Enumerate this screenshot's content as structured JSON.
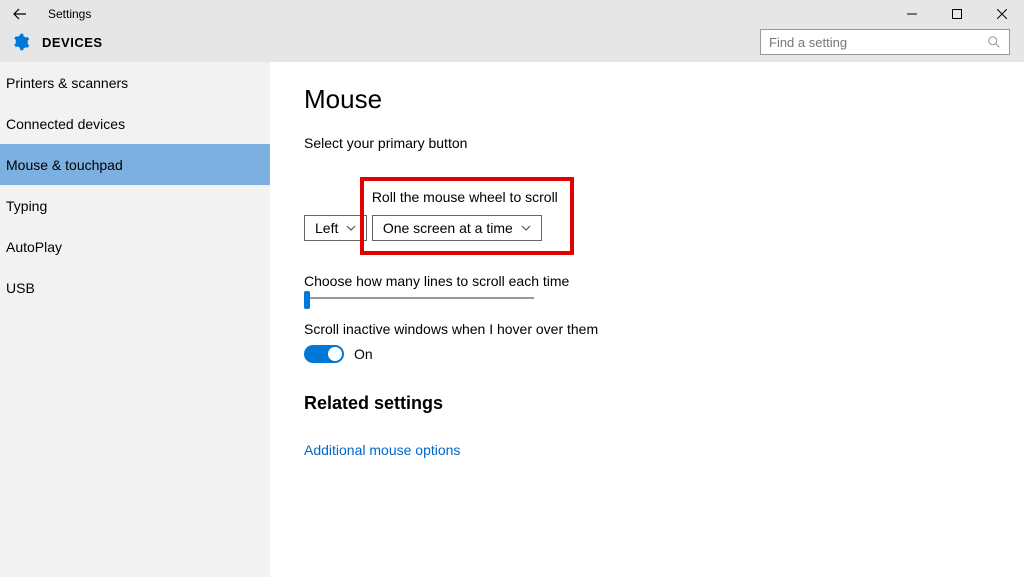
{
  "titlebar": {
    "title": "Settings"
  },
  "header": {
    "title": "DEVICES",
    "search_placeholder": "Find a setting"
  },
  "sidebar": {
    "items": [
      {
        "label": "Printers & scanners"
      },
      {
        "label": "Connected devices"
      },
      {
        "label": "Mouse & touchpad"
      },
      {
        "label": "Typing"
      },
      {
        "label": "AutoPlay"
      },
      {
        "label": "USB"
      }
    ]
  },
  "main": {
    "title": "Mouse",
    "primary_button_label": "Select your primary button",
    "primary_button_value": "Left",
    "scroll_mode_label": "Roll the mouse wheel to scroll",
    "scroll_mode_value": "One screen at a time",
    "lines_label": "Choose how many lines to scroll each time",
    "inactive_label": "Scroll inactive windows when I hover over them",
    "inactive_value": "On",
    "related_title": "Related settings",
    "related_link": "Additional mouse options"
  }
}
